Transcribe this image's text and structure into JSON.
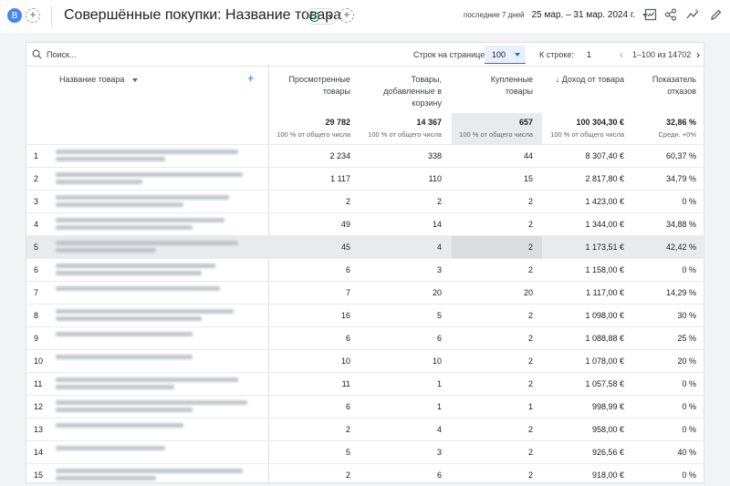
{
  "topbar": {
    "avatar_letter": "B",
    "add_button": "+",
    "add_button2": "+",
    "title": "Совершённые покупки: Название товара",
    "date_label": "последние 7 дней",
    "date_value": "25 мар. – 31 мар. 2024 г."
  },
  "toolbar": {
    "search_placeholder": "Поиск...",
    "rows_per_page_label": "Строк на странице:",
    "rows_per_page_value": "100",
    "goto_row_label": "К строке:",
    "goto_row_value": "1",
    "range_text": "1–100 из 14702"
  },
  "table": {
    "dimension_header": "Название товара",
    "add_dimension": "+",
    "columns": [
      {
        "label": "Просмотренные товары",
        "total": "29 782",
        "sub": "100 % от общего числа"
      },
      {
        "label": "Товары, добавленные в корзину",
        "total": "14 367",
        "sub": "100 % от общего числа"
      },
      {
        "label": "Купленные товары",
        "total": "657",
        "sub": "100 % от общего числа"
      },
      {
        "label": "↓ Доход от товара",
        "total": "100 304,30 €",
        "sub": "100 % от общего числа"
      },
      {
        "label": "Показатель отказов",
        "total": "32,86 %",
        "sub": "Средн. +0%"
      }
    ],
    "rows": [
      {
        "n": "1",
        "c": [
          "2 234",
          "338",
          "44",
          "8 307,40 €",
          "60,37 %"
        ]
      },
      {
        "n": "2",
        "c": [
          "1 117",
          "110",
          "15",
          "2 817,80 €",
          "34,79 %"
        ]
      },
      {
        "n": "3",
        "c": [
          "2",
          "2",
          "2",
          "1 423,00 €",
          "0 %"
        ]
      },
      {
        "n": "4",
        "c": [
          "49",
          "14",
          "2",
          "1 344,00 €",
          "34,88 %"
        ]
      },
      {
        "n": "5",
        "c": [
          "45",
          "4",
          "2",
          "1 173,51 €",
          "42,42 %"
        ]
      },
      {
        "n": "6",
        "c": [
          "6",
          "3",
          "2",
          "1 158,00 €",
          "0 %"
        ]
      },
      {
        "n": "7",
        "c": [
          "7",
          "20",
          "20",
          "1 117,00 €",
          "14,29 %"
        ]
      },
      {
        "n": "8",
        "c": [
          "16",
          "5",
          "2",
          "1 098,00 €",
          "30 %"
        ]
      },
      {
        "n": "9",
        "c": [
          "6",
          "6",
          "2",
          "1 088,88 €",
          "25 %"
        ]
      },
      {
        "n": "10",
        "c": [
          "10",
          "10",
          "2",
          "1 078,00 €",
          "20 %"
        ]
      },
      {
        "n": "11",
        "c": [
          "11",
          "1",
          "2",
          "1 057,58 €",
          "0 %"
        ]
      },
      {
        "n": "12",
        "c": [
          "6",
          "1",
          "1",
          "998,99 €",
          "0 %"
        ]
      },
      {
        "n": "13",
        "c": [
          "2",
          "4",
          "2",
          "958,00 €",
          "0 %"
        ]
      },
      {
        "n": "14",
        "c": [
          "5",
          "3",
          "2",
          "926,56 €",
          "40 %"
        ]
      },
      {
        "n": "15",
        "c": [
          "2",
          "6",
          "2",
          "918,00 €",
          "0 %"
        ]
      }
    ]
  },
  "colors": {
    "accent": "#1a73e8",
    "avatar": "#4285f4",
    "highlight": "#e8eaed"
  }
}
